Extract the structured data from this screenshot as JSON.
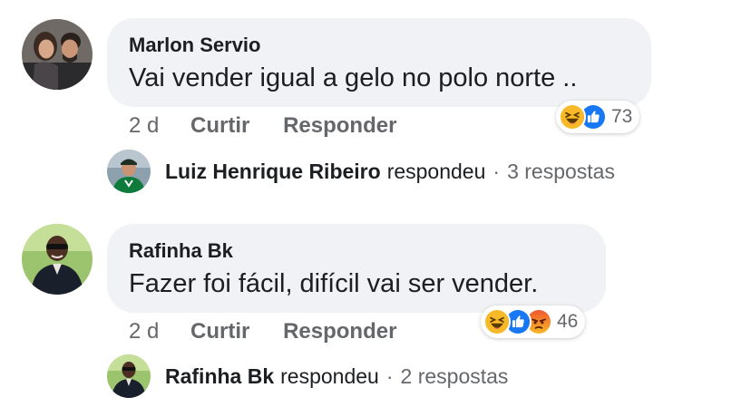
{
  "comments": [
    {
      "author": "Marlon Servio",
      "text": "Vai vender igual a gelo no polo norte ..",
      "time": "2 d",
      "like_label": "Curtir",
      "reply_label": "Responder",
      "reactions": [
        "haha",
        "like"
      ],
      "reaction_count": "73",
      "reply": {
        "name": "Luiz Henrique Ribeiro",
        "verb": "respondeu",
        "separator": "·",
        "count": "3 respostas"
      }
    },
    {
      "author": "Rafinha Bk",
      "text": "Fazer foi fácil, difícil vai ser vender.",
      "time": "2 d",
      "like_label": "Curtir",
      "reply_label": "Responder",
      "reactions": [
        "haha",
        "like",
        "angry"
      ],
      "reaction_count": "46",
      "reply": {
        "name": "Rafinha Bk",
        "verb": "respondeu",
        "separator": "·",
        "count": "2 respostas"
      }
    }
  ],
  "colors": {
    "bubble": "#f0f2f5",
    "meta_text": "#65676b",
    "like_blue": "#1877f2",
    "haha_yellow": "#f7b928",
    "angry_orange": "#e9710f"
  }
}
